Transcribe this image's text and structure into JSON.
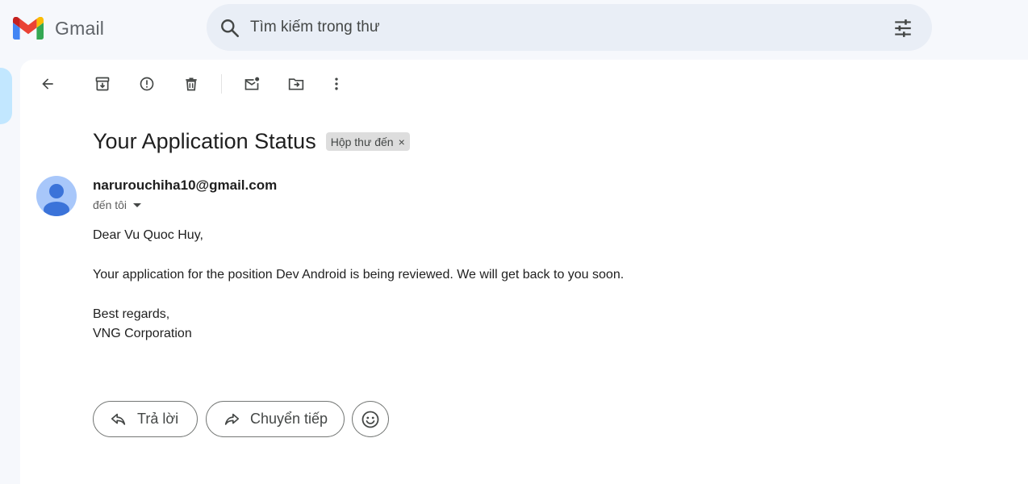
{
  "header": {
    "logo_text": "Gmail",
    "search": {
      "placeholder": "Tìm kiếm trong thư",
      "value": ""
    }
  },
  "toolbar": {
    "items": [
      {
        "name": "back-icon"
      },
      {
        "name": "archive-icon"
      },
      {
        "name": "report-spam-icon"
      },
      {
        "name": "delete-icon"
      },
      {
        "name": "mark-unread-icon"
      },
      {
        "name": "move-to-icon"
      },
      {
        "name": "more-options-icon"
      }
    ]
  },
  "message": {
    "subject": "Your Application Status",
    "label": "Hộp thư đến",
    "label_close": "×",
    "sender": "narurouchiha10@gmail.com",
    "recipient": "đến tôi",
    "body": {
      "greeting": "Dear Vu Quoc Huy,",
      "line1": "Your application for the position Dev Android is being reviewed. We will get back to you soon.",
      "closing": "Best regards,",
      "signature": "VNG Corporation"
    }
  },
  "actions": {
    "reply_label": "Trả lời",
    "forward_label": "Chuyển tiếp",
    "emoji_icon": "emoji-icon"
  },
  "colors": {
    "background": "#f6f8fc",
    "search_bg": "#e9eef6",
    "nav_active": "#c2e7ff",
    "avatar_bg": "#a8c7fa",
    "avatar_fg": "#3b73d9",
    "gmail_red": "#ea4335",
    "gmail_blue": "#4285f4",
    "gmail_green": "#34a853",
    "gmail_yellow": "#fbbc04"
  }
}
